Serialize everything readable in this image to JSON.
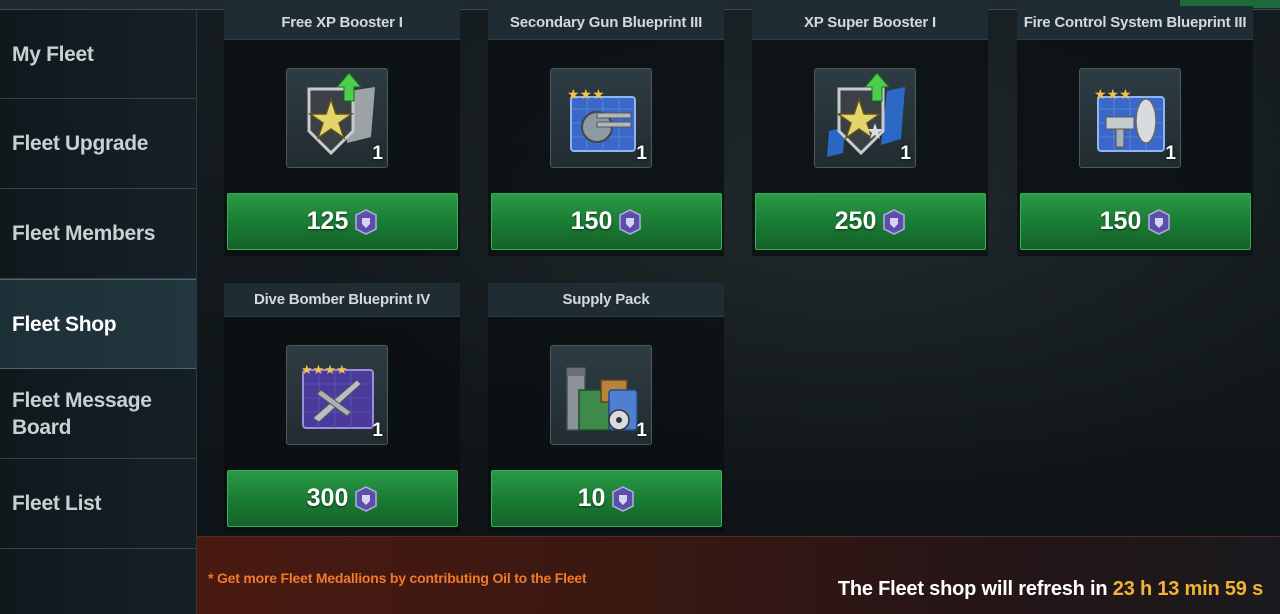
{
  "colors": {
    "accent_green": "#1a7a33",
    "timer_gold": "#f2b233",
    "note_orange": "#f07a2a"
  },
  "sidebar": {
    "items": [
      {
        "label": "My Fleet",
        "active": false
      },
      {
        "label": "Fleet Upgrade",
        "active": false
      },
      {
        "label": "Fleet Members",
        "active": false
      },
      {
        "label": "Fleet Shop",
        "active": true
      },
      {
        "label": "Fleet Message Board",
        "active": false
      },
      {
        "label": "Fleet List",
        "active": false
      }
    ]
  },
  "shop": {
    "currency_icon": "fleet-medallion-icon",
    "items": [
      {
        "title": "Free XP Booster I",
        "quantity": "1",
        "price": "125",
        "icon": "free-xp-booster-icon"
      },
      {
        "title": "Secondary Gun Blueprint III",
        "quantity": "1",
        "price": "150",
        "icon": "secondary-gun-blueprint-icon"
      },
      {
        "title": "XP Super Booster I",
        "quantity": "1",
        "price": "250",
        "icon": "xp-super-booster-icon"
      },
      {
        "title": "Fire Control System Blueprint III",
        "quantity": "1",
        "price": "150",
        "icon": "fire-control-blueprint-icon"
      },
      {
        "title": "Dive Bomber Blueprint IV",
        "quantity": "1",
        "price": "300",
        "icon": "dive-bomber-blueprint-icon"
      },
      {
        "title": "Supply Pack",
        "quantity": "1",
        "price": "10",
        "icon": "supply-pack-icon"
      }
    ]
  },
  "footer": {
    "note": "* Get more Fleet Medallions by contributing Oil to the Fleet",
    "refresh_prefix": "The Fleet shop will refresh in ",
    "refresh_time": "23 h 13 min 59 s"
  }
}
